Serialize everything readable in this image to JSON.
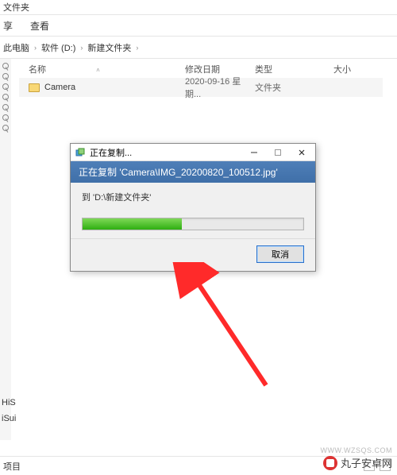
{
  "window": {
    "title": "文件夹",
    "menu": {
      "share": "享",
      "view": "查看"
    }
  },
  "breadcrumb": {
    "b0": "此电脑",
    "b1": "软件 (D:)",
    "b2": "新建文件夹"
  },
  "columns": {
    "name": "名称",
    "date": "修改日期",
    "type": "类型",
    "size": "大小"
  },
  "rows": [
    {
      "name": "Camera",
      "date": "2020-09-16 星期...",
      "type": "文件夹",
      "size": ""
    }
  ],
  "sidebar_bottom": {
    "i0": "HiS",
    "i1": "iSui"
  },
  "status": {
    "text": "项目"
  },
  "dialog": {
    "title": "正在复制...",
    "header_prefix": "正在复制 '",
    "header_path": "Camera\\IMG_20200820_100512.jpg",
    "header_suffix": "'",
    "dest_prefix": "到 '",
    "dest_path": "D:\\新建文件夹",
    "dest_suffix": "'",
    "cancel": "取消",
    "progress_pct": 45
  },
  "watermark": {
    "name": "丸子安卓网",
    "url": "WWW.WZSQS.COM"
  }
}
